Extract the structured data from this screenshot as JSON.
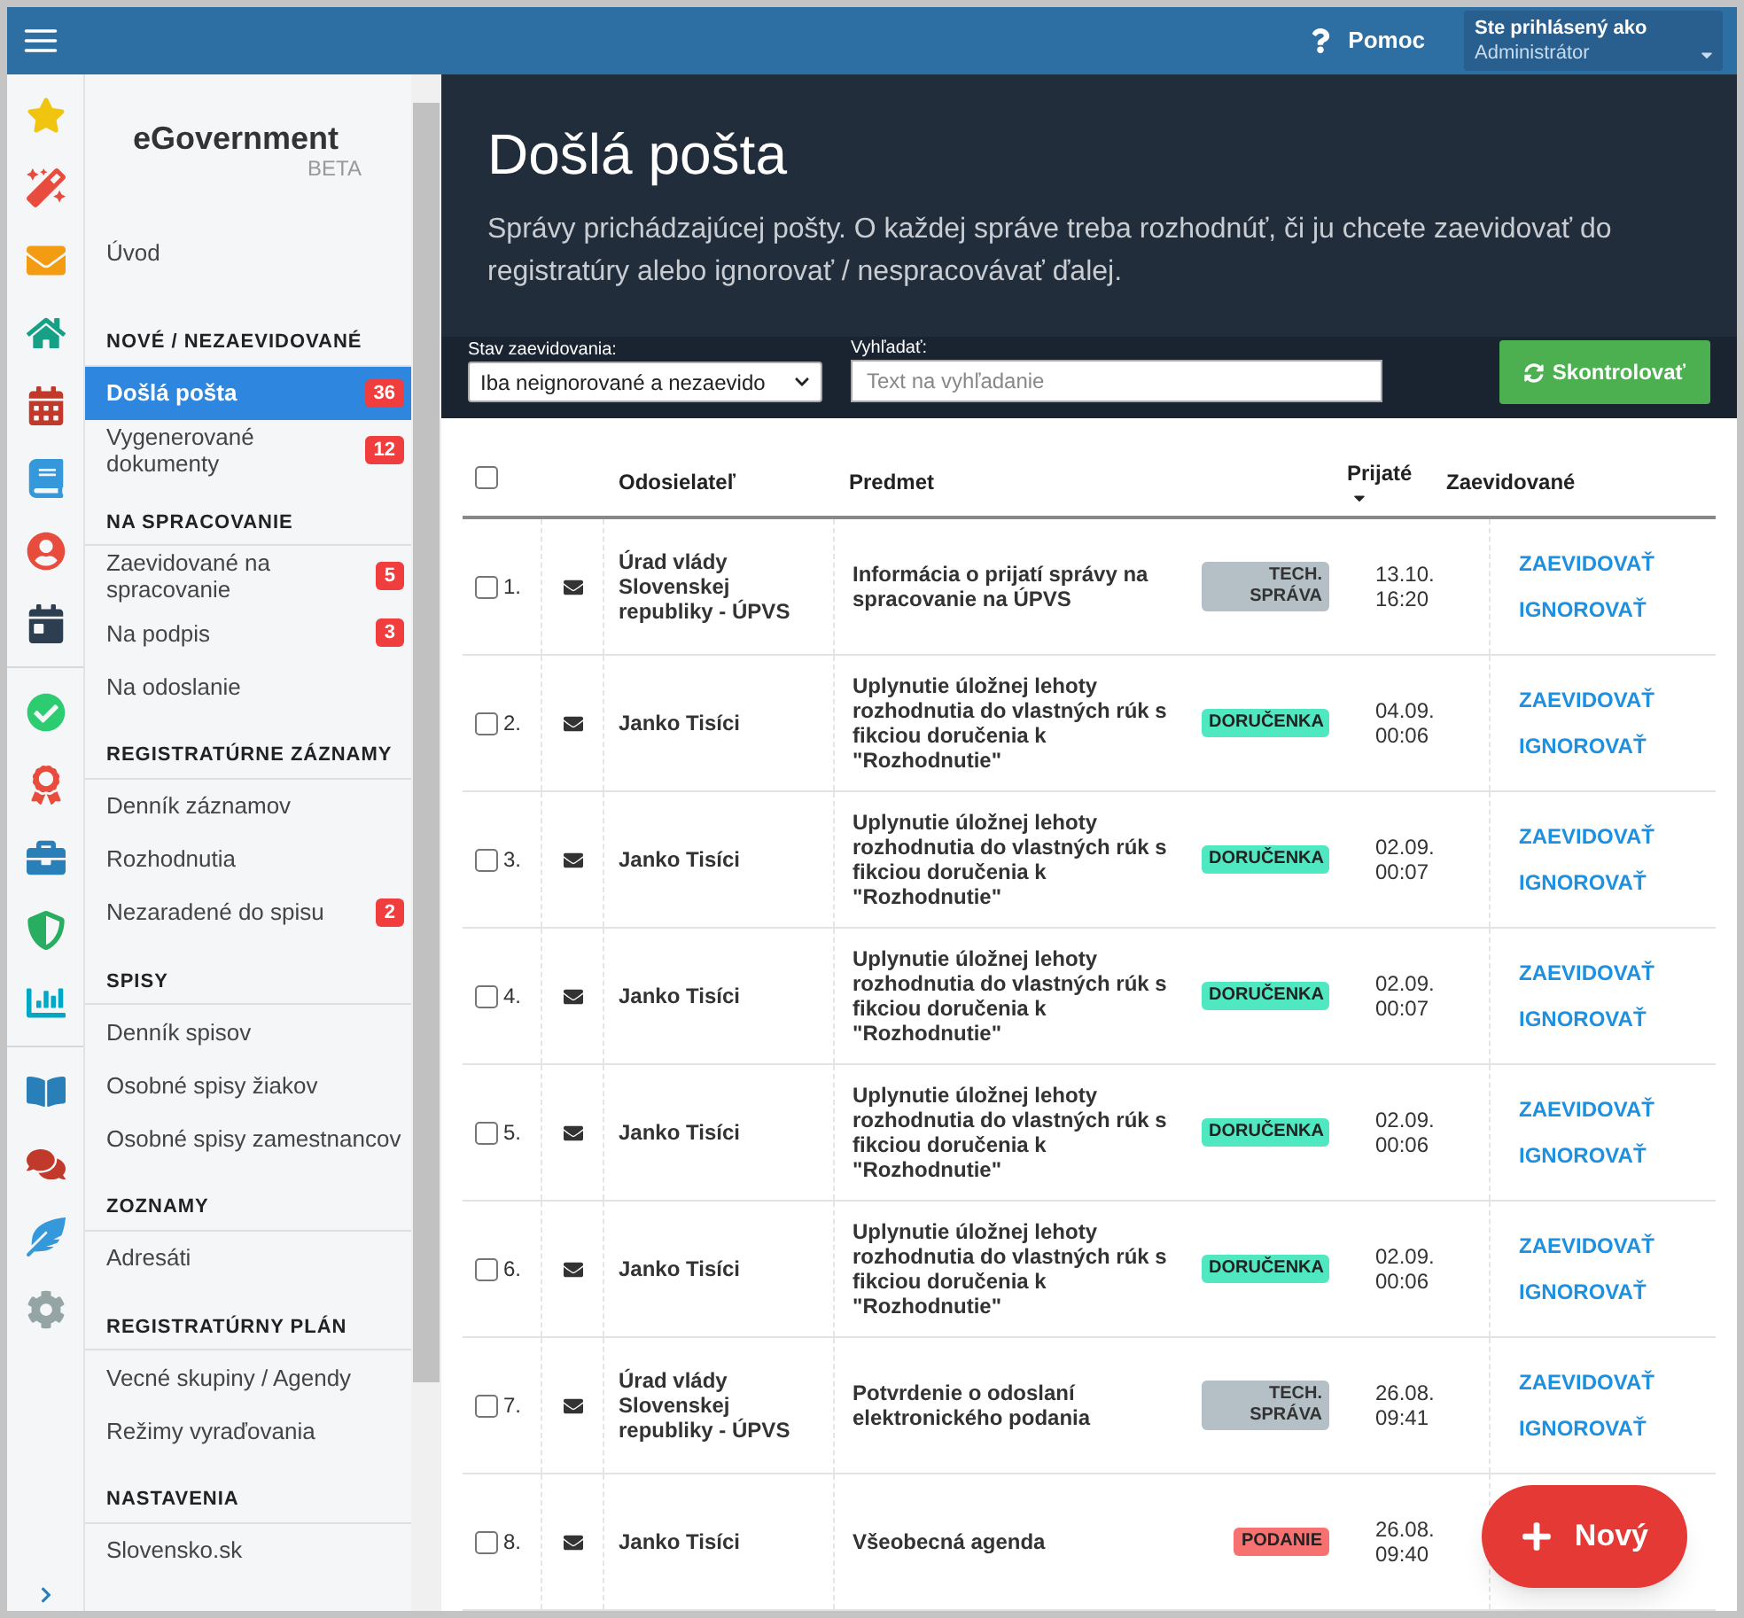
{
  "top_bar": {
    "help": "Pomoc",
    "user_label": "Ste prihlásený ako",
    "user_name": "Administrátor"
  },
  "sidebar": {
    "brand": "eGovernment",
    "brand_tag": "BETA",
    "sections": [
      {
        "items": [
          {
            "label": "Úvod",
            "selected": false
          }
        ]
      },
      {
        "title": "NOVÉ / NEZAEVIDOVANÉ",
        "items": [
          {
            "label": "Došlá pošta",
            "badge": "36",
            "selected": true
          },
          {
            "label": "Vygenerované dokumenty",
            "badge": "12",
            "selected": false
          }
        ]
      },
      {
        "title": "NA SPRACOVANIE",
        "items": [
          {
            "label": "Zaevidované na spracovanie",
            "badge": "5",
            "selected": false
          },
          {
            "label": "Na podpis",
            "badge": "3",
            "selected": false
          },
          {
            "label": "Na odoslanie",
            "selected": false
          }
        ]
      },
      {
        "title": "REGISTRATÚRNE ZÁZNAMY",
        "items": [
          {
            "label": "Denník záznamov",
            "selected": false
          },
          {
            "label": "Rozhodnutia",
            "selected": false
          },
          {
            "label": "Nezaradené do spisu",
            "badge": "2",
            "selected": false
          }
        ]
      },
      {
        "title": "SPISY",
        "items": [
          {
            "label": "Denník spisov",
            "selected": false
          },
          {
            "label": "Osobné spisy žiakov",
            "selected": false
          },
          {
            "label": "Osobné spisy zamestnancov",
            "selected": false
          }
        ]
      },
      {
        "title": "ZOZNAMY",
        "items": [
          {
            "label": "Adresáti",
            "selected": false
          }
        ]
      },
      {
        "title": "REGISTRATÚRNY PLÁN",
        "items": [
          {
            "label": "Vecné skupiny / Agendy",
            "selected": false
          },
          {
            "label": "Režimy vyraďovania",
            "selected": false
          }
        ]
      },
      {
        "title": "NASTAVENIA",
        "items": [
          {
            "label": "Slovensko.sk",
            "selected": false
          }
        ]
      }
    ]
  },
  "header": {
    "title": "Došlá pošta",
    "description": "Správy prichádzajúcej pošty. O každej správe treba rozhodnúť, či ju chcete zaevidovať do registratúry alebo ignorovať / nespracovávať ďalej."
  },
  "filters": {
    "status_label": "Stav zaevidovania:",
    "status_value": "Iba neignorované a nezaevido",
    "search_label": "Vyhľadať:",
    "search_placeholder": "Text na vyhľadanie",
    "check_button": "Skontrolovať"
  },
  "table": {
    "select_all_checked": false,
    "columns": {
      "sender": "Odosielateľ",
      "subject": "Predmet",
      "received": "Prijaté",
      "registered": "Zaevidované"
    },
    "rows": [
      {
        "checked": false,
        "number": "1.",
        "sender": "Úrad vlády Slovenskej republiky - ÚPVS",
        "subject": "Informácia o prijatí správy na spracovanie na ÚPVS",
        "tag": {
          "label": "TECH. SPRÁVA",
          "kind": "tech"
        },
        "date": "13.10.",
        "time": "16:20",
        "actions": [
          "ZAEVIDOVAŤ",
          "IGNOROVAŤ"
        ]
      },
      {
        "checked": false,
        "number": "2.",
        "sender": "Janko Tisíci",
        "subject": "Uplynutie úložnej lehoty rozhodnutia do vlastných rúk s fikciou doručenia k \"Rozhodnutie\"",
        "tag": {
          "label": "DORUČENKA",
          "kind": "delivery"
        },
        "date": "04.09.",
        "time": "00:06",
        "actions": [
          "ZAEVIDOVAŤ",
          "IGNOROVAŤ"
        ]
      },
      {
        "checked": false,
        "number": "3.",
        "sender": "Janko Tisíci",
        "subject": "Uplynutie úložnej lehoty rozhodnutia do vlastných rúk s fikciou doručenia k \"Rozhodnutie\"",
        "tag": {
          "label": "DORUČENKA",
          "kind": "delivery"
        },
        "date": "02.09.",
        "time": "00:07",
        "actions": [
          "ZAEVIDOVAŤ",
          "IGNOROVAŤ"
        ]
      },
      {
        "checked": false,
        "number": "4.",
        "sender": "Janko Tisíci",
        "subject": "Uplynutie úložnej lehoty rozhodnutia do vlastných rúk s fikciou doručenia k \"Rozhodnutie\"",
        "tag": {
          "label": "DORUČENKA",
          "kind": "delivery"
        },
        "date": "02.09.",
        "time": "00:07",
        "actions": [
          "ZAEVIDOVAŤ",
          "IGNOROVAŤ"
        ]
      },
      {
        "checked": false,
        "number": "5.",
        "sender": "Janko Tisíci",
        "subject": "Uplynutie úložnej lehoty rozhodnutia do vlastných rúk s fikciou doručenia k \"Rozhodnutie\"",
        "tag": {
          "label": "DORUČENKA",
          "kind": "delivery"
        },
        "date": "02.09.",
        "time": "00:06",
        "actions": [
          "ZAEVIDOVAŤ",
          "IGNOROVAŤ"
        ]
      },
      {
        "checked": false,
        "number": "6.",
        "sender": "Janko Tisíci",
        "subject": "Uplynutie úložnej lehoty rozhodnutia do vlastných rúk s fikciou doručenia k \"Rozhodnutie\"",
        "tag": {
          "label": "DORUČENKA",
          "kind": "delivery"
        },
        "date": "02.09.",
        "time": "00:06",
        "actions": [
          "ZAEVIDOVAŤ",
          "IGNOROVAŤ"
        ]
      },
      {
        "checked": false,
        "number": "7.",
        "sender": "Úrad vlády Slovenskej republiky - ÚPVS",
        "subject": "Potvrdenie o odoslaní elektronického podania",
        "tag": {
          "label": "TECH. SPRÁVA",
          "kind": "tech"
        },
        "date": "26.08.",
        "time": "09:41",
        "actions": [
          "ZAEVIDOVAŤ",
          "IGNOROVAŤ"
        ]
      },
      {
        "checked": false,
        "number": "8.",
        "sender": "Janko Tisíci",
        "subject": "Všeobecná agenda",
        "tag": {
          "label": "PODANIE",
          "kind": "filing"
        },
        "date": "26.08.",
        "time": "09:40",
        "actions": []
      }
    ]
  },
  "new_button": "Nový"
}
